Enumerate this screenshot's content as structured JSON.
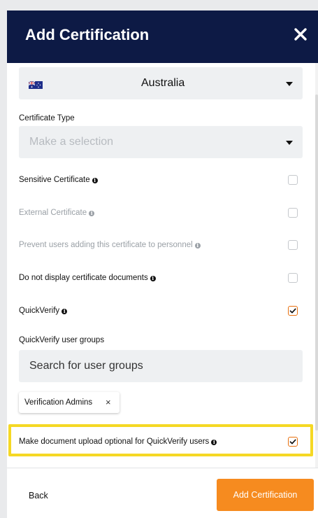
{
  "modal": {
    "title": "Add Certification",
    "close_icon": "close-icon"
  },
  "country": {
    "value": "Australia",
    "flag_icon": "australia-flag-icon"
  },
  "certificate_type": {
    "label": "Certificate Type",
    "placeholder": "Make a selection"
  },
  "options": [
    {
      "label": "Sensitive Certificate",
      "checked": false,
      "enabled": true
    },
    {
      "label": "External Certificate",
      "checked": false,
      "enabled": false
    },
    {
      "label": "Prevent users adding this certificate to personnel",
      "checked": false,
      "enabled": false
    },
    {
      "label": "Do not display certificate documents",
      "checked": false,
      "enabled": true
    },
    {
      "label": "QuickVerify",
      "checked": true,
      "enabled": true
    }
  ],
  "user_groups": {
    "label": "QuickVerify user groups",
    "search_placeholder": "Search for user groups",
    "chips": [
      {
        "label": "Verification Admins"
      }
    ]
  },
  "optional_upload": {
    "label": "Make document upload optional for QuickVerify users",
    "checked": true
  },
  "footer": {
    "back_label": "Back",
    "primary_label": "Add Certification"
  },
  "colors": {
    "header_bg": "#0d1a45",
    "accent": "#f68b1f",
    "highlight": "#f5d824"
  }
}
